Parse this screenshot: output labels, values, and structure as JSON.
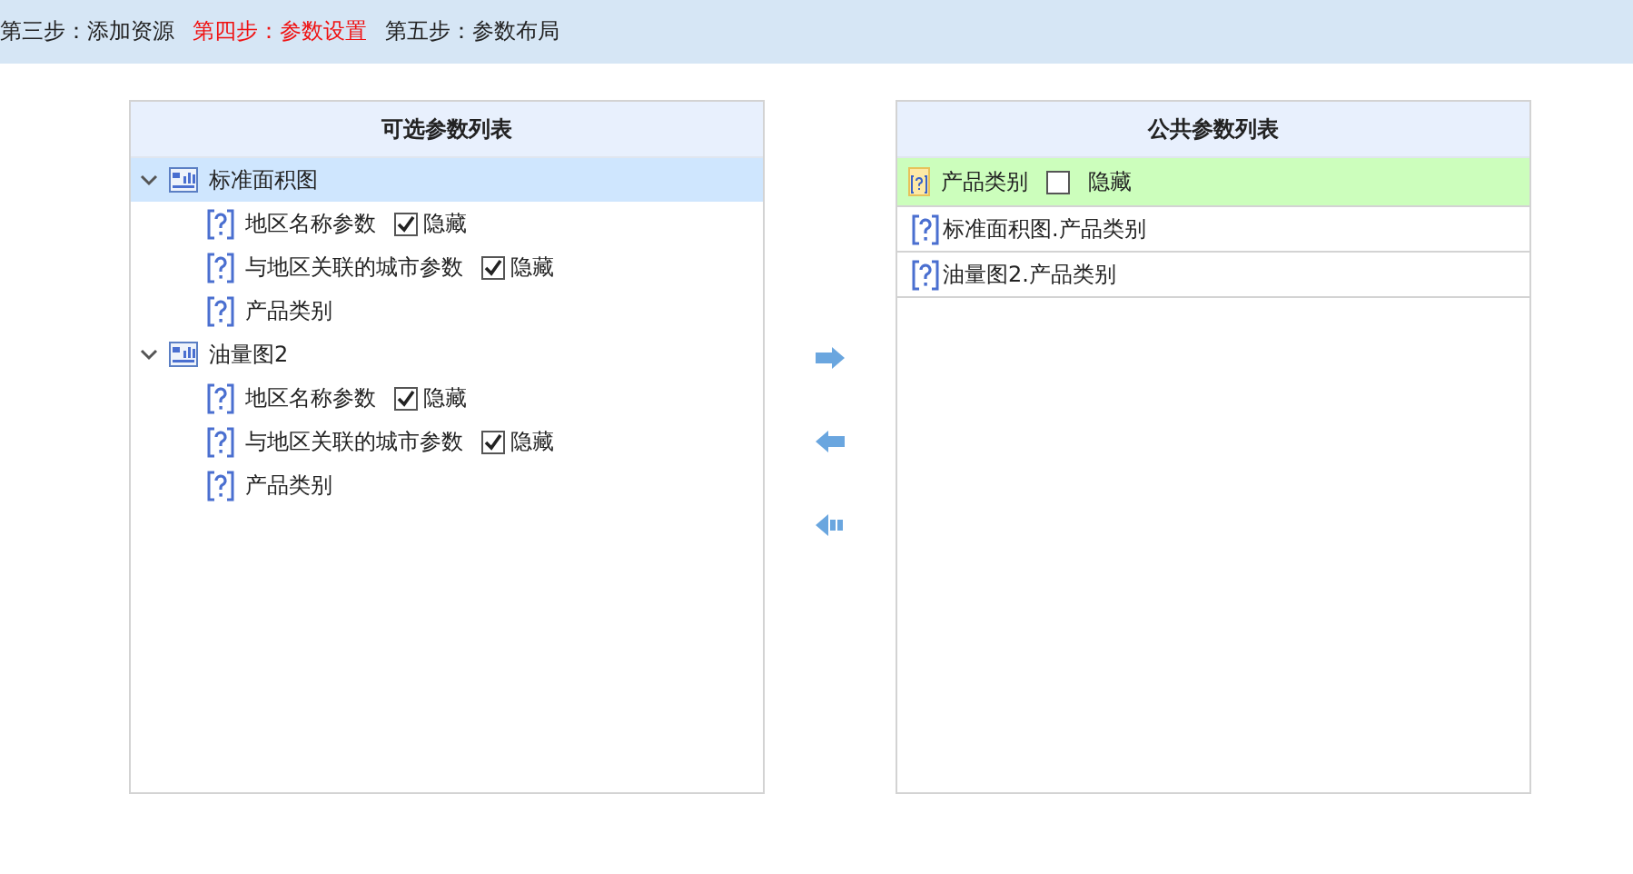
{
  "steps": [
    {
      "label": "第三步：添加资源",
      "selected": false
    },
    {
      "label": "第四步：参数设置",
      "selected": true
    },
    {
      "label": "第五步：参数布局",
      "selected": false
    }
  ],
  "available_params": {
    "title": "可选参数列表",
    "groups": [
      {
        "label": "标准面积图",
        "expanded": true,
        "selected": true,
        "children": [
          {
            "kind": "checkable",
            "label": "地区名称参数",
            "hide_label": "隐藏",
            "checked": true
          },
          {
            "kind": "checkable",
            "label": "与地区关联的城市参数",
            "hide_label": "隐藏",
            "checked": true
          },
          {
            "kind": "plain",
            "label": "产品类别"
          }
        ]
      },
      {
        "label": "油量图2",
        "expanded": true,
        "selected": false,
        "children": [
          {
            "kind": "checkable",
            "label": "地区名称参数",
            "hide_label": "隐藏",
            "checked": true
          },
          {
            "kind": "checkable",
            "label": "与地区关联的城市参数",
            "hide_label": "隐藏",
            "checked": true
          },
          {
            "kind": "plain",
            "label": "产品类别"
          }
        ]
      }
    ]
  },
  "public_params": {
    "title": "公共参数列表",
    "groups": [
      {
        "label": "产品类别",
        "hide_label": "隐藏",
        "checked": false,
        "children": [
          {
            "label": "标准面积图.产品类别"
          },
          {
            "label": "油量图2.产品类别"
          }
        ]
      }
    ]
  }
}
